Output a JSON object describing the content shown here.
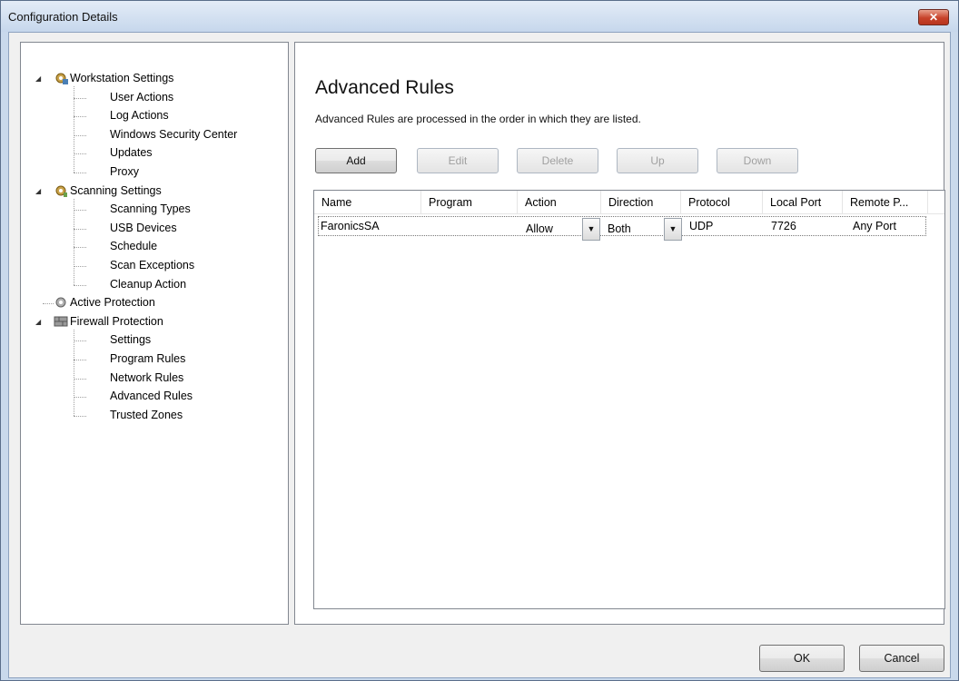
{
  "window": {
    "title": "Configuration Details",
    "close_glyph": "✕"
  },
  "tree": {
    "groups": [
      {
        "label": "Workstation Settings",
        "icon": "workstation-gear-icon",
        "children": [
          "User Actions",
          "Log Actions",
          "Windows Security Center",
          "Updates",
          "Proxy"
        ]
      },
      {
        "label": "Scanning Settings",
        "icon": "scanning-gear-icon",
        "children": [
          "Scanning Types",
          "USB Devices",
          "Schedule",
          "Scan Exceptions",
          "Cleanup Action"
        ]
      },
      {
        "label": "Active Protection",
        "icon": "active-protection-icon",
        "children": []
      },
      {
        "label": "Firewall Protection",
        "icon": "firewall-brick-icon",
        "children": [
          "Settings",
          "Program Rules",
          "Network Rules",
          "Advanced Rules",
          "Trusted Zones"
        ]
      }
    ]
  },
  "main": {
    "title": "Advanced Rules",
    "description": "Advanced Rules are processed in the order in which they are listed.",
    "buttons": [
      {
        "label": "Add",
        "enabled": true
      },
      {
        "label": "Edit",
        "enabled": false
      },
      {
        "label": "Delete",
        "enabled": false
      },
      {
        "label": "Up",
        "enabled": false
      },
      {
        "label": "Down",
        "enabled": false
      }
    ],
    "grid": {
      "columns": [
        "Name",
        "Program",
        "Action",
        "Direction",
        "Protocol",
        "Local Port",
        "Remote P..."
      ],
      "rows": [
        {
          "name": "FaronicsSA",
          "program": "",
          "action": "Allow",
          "direction": "Both",
          "protocol": "UDP",
          "local_port": "7726",
          "remote_port": "Any Port"
        }
      ]
    }
  },
  "footer": {
    "ok": "OK",
    "cancel": "Cancel"
  },
  "colors": {
    "title_bar": "#c6d7ec",
    "close": "#c7422a",
    "panel_border": "#828790"
  }
}
